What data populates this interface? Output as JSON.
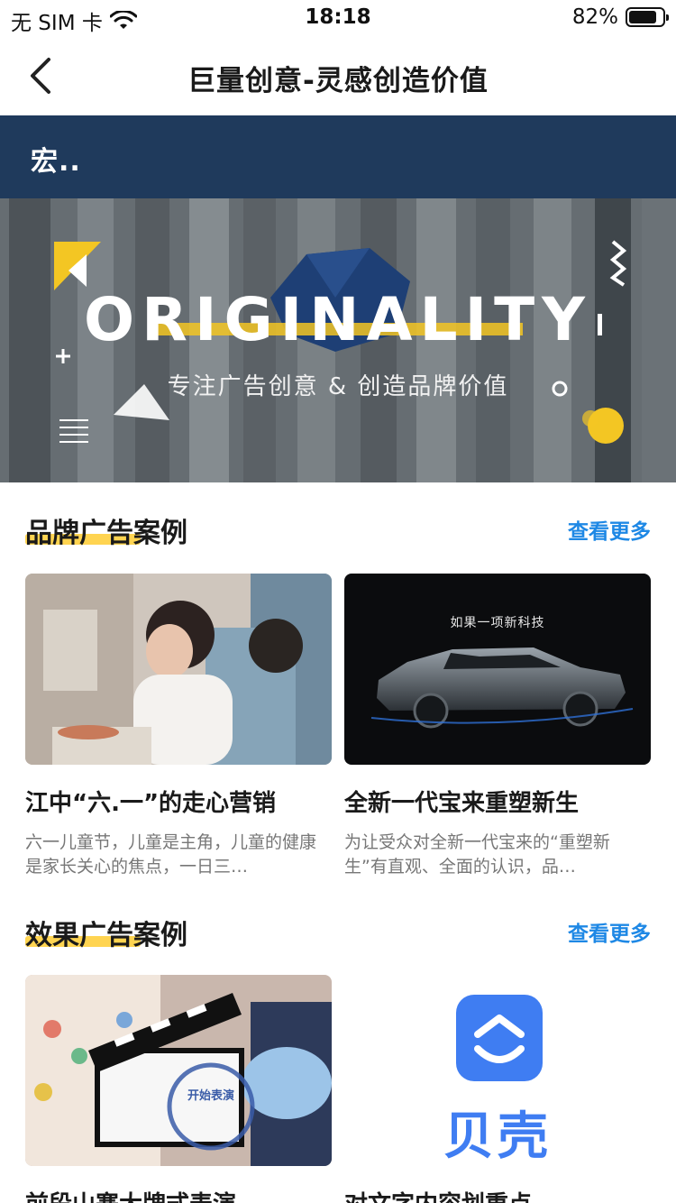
{
  "status_bar": {
    "carrier": "无 SIM 卡",
    "time": "18:18",
    "battery_percent": "82%",
    "battery_level": 0.82
  },
  "nav": {
    "title": "巨量创意-灵感创造价值"
  },
  "header": {
    "text": "宏.."
  },
  "hero": {
    "title": "ORIGINALITY",
    "subtitle": "专注广告创意 & 创造品牌价值"
  },
  "sections": [
    {
      "title": "品牌广告案例",
      "more": "查看更多",
      "cards": [
        {
          "title": "江中“六.一”的走心营销",
          "desc": "六一儿童节，儿童是主角，儿童的健康是家长关心的焦点，一日三…"
        },
        {
          "title": "全新一代宝来重塑新生",
          "desc": "为让受众对全新一代宝来的“重塑新生”有直观、全面的认识，品…",
          "image_caption": "如果一项新科技"
        }
      ]
    },
    {
      "title": "效果广告案例",
      "more": "查看更多",
      "cards": [
        {
          "title": "前段山寨大牌式表演",
          "stamp_text": "开始表演"
        },
        {
          "title": "对文字内容划重点",
          "logo_text": "贝壳"
        }
      ]
    }
  ]
}
